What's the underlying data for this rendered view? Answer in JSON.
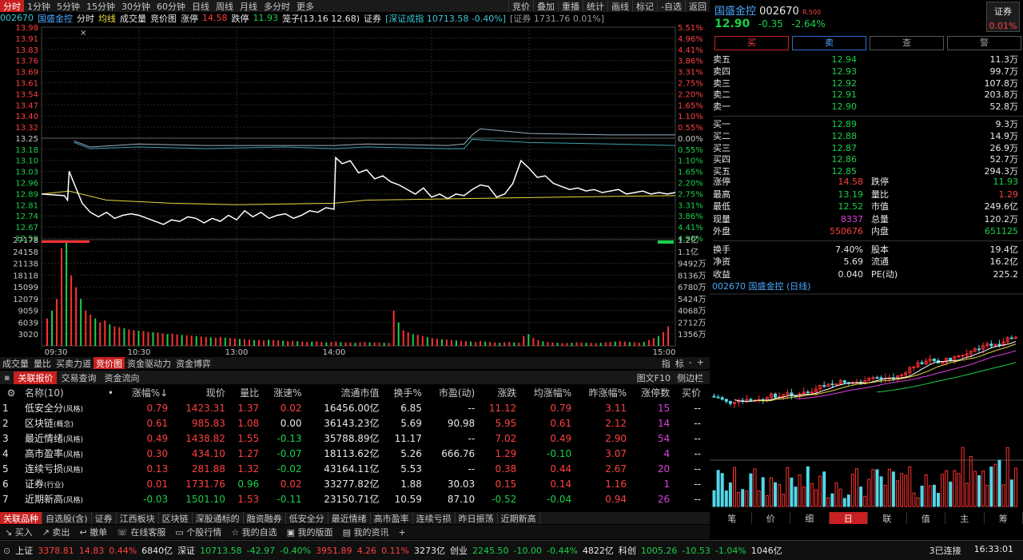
{
  "top_tabs": [
    "分时",
    "1分钟",
    "5分钟",
    "15分钟",
    "30分钟",
    "60分钟",
    "日线",
    "周线",
    "月线",
    "多分时",
    "更多"
  ],
  "top_tools": [
    "竞价",
    "叠加",
    "重播",
    "统计",
    "画线",
    "标记",
    "-自选",
    "返回"
  ],
  "chart_header": {
    "code": "002670",
    "name": "国盛金控",
    "items": [
      "分时",
      "均线",
      "成交量",
      "竞价图"
    ],
    "zt_label": "涨停",
    "zt_val": "14.58",
    "dt_label": "跌停",
    "dt_val": "11.93",
    "bz": "笼子(13.16 12.68)",
    "sec": "证券",
    "idx1": "[深证成指 10713.58 -0.40%]",
    "idx2": "[证券 1731.76 0.01%]"
  },
  "chart_data": {
    "type": "line",
    "time_ticks": [
      "09:30",
      "10:30",
      "13:00",
      "14:00",
      "15:00"
    ],
    "price_ticks": [
      "13.98",
      "13.91",
      "13.83",
      "13.76",
      "13.69",
      "13.61",
      "13.54",
      "13.47",
      "13.40",
      "13.32",
      "13.25",
      "13.18",
      "13.10",
      "13.03",
      "12.96",
      "12.89",
      "12.81",
      "12.74",
      "12.67",
      "12.59"
    ],
    "pct_ticks": [
      "5.51%",
      "4.96%",
      "4.41%",
      "3.86%",
      "3.31%",
      "2.75%",
      "2.20%",
      "1.65%",
      "1.10%",
      "0.55%",
      "0.00%",
      "0.55%",
      "1.10%",
      "1.65%",
      "2.20%",
      "2.75%",
      "3.31%",
      "3.86%",
      "4.41%",
      "4.96%"
    ],
    "pct_colors": [
      "#ff4040",
      "#ff4040",
      "#ff4040",
      "#ff4040",
      "#ff4040",
      "#ff4040",
      "#ff4040",
      "#ff4040",
      "#ff4040",
      "#ff4040",
      "#c8c8c8",
      "#19d04a",
      "#19d04a",
      "#19d04a",
      "#19d04a",
      "#19d04a",
      "#19d04a",
      "#19d04a",
      "#19d04a",
      "#19d04a"
    ],
    "ylim": [
      12.59,
      13.98
    ],
    "prev_close": 13.25,
    "price_series": [
      [
        0,
        12.88
      ],
      [
        14,
        12.87
      ],
      [
        16,
        12.84
      ],
      [
        17,
        13.03
      ],
      [
        20,
        12.95
      ],
      [
        25,
        12.82
      ],
      [
        30,
        12.76
      ],
      [
        35,
        12.73
      ],
      [
        40,
        12.76
      ],
      [
        45,
        12.72
      ],
      [
        50,
        12.74
      ],
      [
        55,
        12.75
      ],
      [
        60,
        12.74
      ],
      [
        65,
        12.72
      ],
      [
        70,
        12.7
      ],
      [
        75,
        12.68
      ],
      [
        80,
        12.71
      ],
      [
        85,
        12.7
      ],
      [
        90,
        12.73
      ],
      [
        95,
        12.72
      ],
      [
        100,
        12.69
      ],
      [
        105,
        12.72
      ],
      [
        110,
        12.7
      ],
      [
        115,
        12.74
      ],
      [
        120,
        12.71
      ],
      [
        125,
        12.77
      ],
      [
        130,
        12.73
      ],
      [
        135,
        12.76
      ],
      [
        140,
        12.72
      ],
      [
        145,
        12.74
      ],
      [
        150,
        12.75
      ],
      [
        155,
        12.72
      ],
      [
        160,
        12.74
      ],
      [
        165,
        12.77
      ],
      [
        170,
        12.76
      ],
      [
        175,
        12.79
      ],
      [
        180,
        12.78
      ],
      [
        181,
        13.12
      ],
      [
        185,
        13.08
      ],
      [
        190,
        13.1
      ],
      [
        195,
        13.02
      ],
      [
        200,
        13.04
      ],
      [
        205,
        12.98
      ],
      [
        210,
        13.0
      ],
      [
        215,
        12.96
      ],
      [
        220,
        12.94
      ],
      [
        225,
        12.91
      ],
      [
        230,
        12.88
      ],
      [
        235,
        12.92
      ],
      [
        240,
        12.86
      ],
      [
        245,
        12.88
      ],
      [
        250,
        12.85
      ],
      [
        255,
        12.88
      ],
      [
        260,
        12.87
      ],
      [
        265,
        12.91
      ],
      [
        270,
        12.94
      ],
      [
        275,
        12.93
      ],
      [
        280,
        12.86
      ],
      [
        285,
        12.88
      ],
      [
        290,
        12.95
      ],
      [
        295,
        13.1
      ],
      [
        300,
        13.05
      ],
      [
        305,
        12.99
      ],
      [
        310,
        13.0
      ],
      [
        315,
        12.95
      ],
      [
        320,
        12.93
      ],
      [
        325,
        12.91
      ],
      [
        330,
        12.92
      ],
      [
        335,
        12.9
      ],
      [
        340,
        12.91
      ],
      [
        345,
        12.89
      ],
      [
        350,
        12.9
      ],
      [
        355,
        12.91
      ],
      [
        360,
        12.88
      ],
      [
        365,
        12.89
      ],
      [
        370,
        12.9
      ],
      [
        375,
        12.88
      ],
      [
        380,
        12.89
      ],
      [
        385,
        12.88
      ],
      [
        390,
        12.89
      ]
    ],
    "avg_series": [
      [
        0,
        12.88
      ],
      [
        17,
        12.9
      ],
      [
        40,
        12.84
      ],
      [
        80,
        12.82
      ],
      [
        120,
        12.81
      ],
      [
        180,
        12.82
      ],
      [
        200,
        12.84
      ],
      [
        260,
        12.85
      ],
      [
        320,
        12.86
      ],
      [
        390,
        12.87
      ]
    ],
    "idx_series1": [
      [
        20,
        13.23
      ],
      [
        30,
        13.19
      ],
      [
        60,
        13.21
      ],
      [
        100,
        13.2
      ],
      [
        150,
        13.2
      ],
      [
        180,
        13.2
      ],
      [
        200,
        13.21
      ],
      [
        250,
        13.2
      ],
      [
        260,
        13.21
      ],
      [
        265,
        13.27
      ],
      [
        270,
        13.31
      ],
      [
        300,
        13.28
      ],
      [
        350,
        13.27
      ],
      [
        390,
        13.27
      ]
    ],
    "idx_series2": [
      [
        20,
        13.22
      ],
      [
        30,
        13.18
      ],
      [
        60,
        13.19
      ],
      [
        100,
        13.18
      ],
      [
        150,
        13.19
      ],
      [
        180,
        13.18
      ],
      [
        200,
        13.19
      ],
      [
        250,
        13.18
      ],
      [
        260,
        13.18
      ],
      [
        265,
        13.24
      ],
      [
        300,
        13.22
      ],
      [
        350,
        13.21
      ],
      [
        390,
        13.2
      ]
    ],
    "vol_ticks": [
      "27178",
      "24158",
      "21138",
      "18118",
      "15099",
      "12079",
      "9059",
      "6039",
      "3020"
    ],
    "amt_ticks": [
      "1.2亿",
      "1.1亿",
      "9492万",
      "8136万",
      "6780万",
      "5424万",
      "4068万",
      "2712万",
      "1356万"
    ],
    "vol_max": 27178,
    "vol_series": [
      7000,
      9000,
      12000,
      25000,
      27000,
      18000,
      15000,
      12000,
      9000,
      8000,
      7000,
      6000,
      6500,
      5500,
      5000,
      4800,
      4500,
      4200,
      4000,
      3900,
      3800,
      3600,
      3500,
      3400,
      3200,
      3000,
      3100,
      2900,
      2800,
      2700,
      2600,
      2500,
      2400,
      2300,
      2200,
      2100,
      2300,
      2100,
      2000,
      1900,
      1800,
      1700,
      1600,
      1500,
      1500,
      1400,
      1600,
      1500,
      1400,
      1300,
      1200,
      1300,
      1200,
      1100,
      1000,
      1100,
      1200,
      1000,
      900,
      1000,
      1100,
      950,
      900,
      850,
      800,
      900,
      1000,
      950,
      900,
      850,
      800,
      750,
      9000,
      6000,
      4000,
      3500,
      3000,
      2800,
      2500,
      2200,
      2000,
      1800,
      1700,
      1600,
      1500,
      1400,
      1300,
      1200,
      1100,
      1000,
      1200,
      1100,
      1000,
      900,
      800,
      900,
      1000,
      900,
      800,
      2500,
      3000,
      2000,
      1500,
      1200,
      1000,
      900,
      800,
      700,
      750,
      800,
      900,
      850,
      800,
      750,
      700,
      800,
      900,
      1000,
      1100,
      1200,
      1100,
      1000,
      900,
      800,
      1000,
      1500,
      2000,
      2500,
      3500,
      5000
    ]
  },
  "ind_tabs": [
    "成交量",
    "量比",
    "买卖力道",
    "竞价图",
    "资金驱动力",
    "资金博弈"
  ],
  "ind_tabs_active": 3,
  "ind_right": [
    "指",
    "标",
    "-",
    "+"
  ],
  "low_tabs": [
    "关联报价",
    "交易查询",
    "资金流向"
  ],
  "low_right": [
    "图文F10",
    "侧边栏"
  ],
  "table": {
    "headers": [
      "名称(10)",
      "•",
      "涨幅%↓",
      "现价",
      "量比",
      "涨速%",
      "流通市值",
      "换手%",
      "市盈(动)",
      "涨跌",
      "均涨幅%",
      "昨涨幅%",
      "涨停数",
      "买价"
    ],
    "rows": [
      {
        "no": "1",
        "name": "低安全分",
        "tag": "(风格)",
        "zf": "0.79",
        "xj": "1423.31",
        "lb": "1.37",
        "zs": "0.02",
        "lt": "16456.00亿",
        "hs": "6.85",
        "sy": "--",
        "zd": "11.12",
        "jz": "0.79",
        "zz": "3.11",
        "zt": "15",
        "mj": "--"
      },
      {
        "no": "2",
        "name": "区块链",
        "tag": "(概念)",
        "zf": "0.61",
        "xj": "985.83",
        "lb": "1.08",
        "zs": "0.00",
        "lt": "36143.23亿",
        "hs": "5.69",
        "sy": "90.98",
        "zd": "5.95",
        "jz": "0.61",
        "zz": "2.12",
        "zt": "14",
        "mj": "--"
      },
      {
        "no": "3",
        "name": "最近情绪",
        "tag": "(风格)",
        "zf": "0.49",
        "xj": "1438.82",
        "lb": "1.55",
        "zs": "-0.13",
        "lt": "35788.89亿",
        "hs": "11.17",
        "sy": "--",
        "zd": "7.02",
        "jz": "0.49",
        "zz": "2.90",
        "zt": "54",
        "mj": "--"
      },
      {
        "no": "4",
        "name": "高市盈率",
        "tag": "(风格)",
        "zf": "0.30",
        "xj": "434.10",
        "lb": "1.27",
        "zs": "-0.07",
        "lt": "18113.62亿",
        "hs": "5.26",
        "sy": "666.76",
        "zd": "1.29",
        "jz": "-0.10",
        "zz": "3.07",
        "zt": "4",
        "mj": "--"
      },
      {
        "no": "5",
        "name": "连续亏损",
        "tag": "(风格)",
        "zf": "0.13",
        "xj": "281.88",
        "lb": "1.32",
        "zs": "-0.02",
        "lt": "43164.11亿",
        "hs": "5.53",
        "sy": "--",
        "zd": "0.38",
        "jz": "0.44",
        "zz": "2.67",
        "zt": "20",
        "mj": "--"
      },
      {
        "no": "6",
        "name": "证券",
        "tag": "(行业)",
        "zf": "0.01",
        "xj": "1731.76",
        "lb": "0.96",
        "zs": "0.02",
        "lt": "33277.82亿",
        "hs": "1.88",
        "sy": "30.03",
        "zd": "0.15",
        "jz": "0.14",
        "zz": "1.16",
        "zt": "1",
        "mj": "--"
      },
      {
        "no": "7",
        "name": "近期新高",
        "tag": "(风格)",
        "zf": "-0.03",
        "xj": "1501.10",
        "lb": "1.53",
        "zs": "-0.11",
        "lt": "23150.71亿",
        "hs": "10.59",
        "sy": "87.10",
        "zd": "-0.52",
        "jz": "-0.04",
        "zz": "0.94",
        "zt": "26",
        "mj": "--"
      }
    ]
  },
  "sec_tabs": [
    "关联品种",
    "自选股(含)",
    "证券",
    "江西板块",
    "区块链",
    "深股通标的",
    "融资融券",
    "低安全分",
    "最近情绪",
    "高市盈率",
    "连续亏损",
    "昨日振荡",
    "近期新高"
  ],
  "actions": [
    "买入",
    "卖出",
    "撤单",
    "在线客服",
    "个股行情",
    "我的自选",
    "我的版面",
    "我的资讯",
    "+"
  ],
  "status": [
    {
      "t": "上证",
      "c": "#e8e8e8"
    },
    {
      "t": "3378.81",
      "c": "#ff4040"
    },
    {
      "t": "14.83",
      "c": "#ff4040"
    },
    {
      "t": "0.44%",
      "c": "#ff4040"
    },
    {
      "t": "6840亿",
      "c": "#e8e8e8"
    },
    {
      "t": "深证",
      "c": "#e8e8e8"
    },
    {
      "t": "10713.58",
      "c": "#19d04a"
    },
    {
      "t": "-42.97",
      "c": "#19d04a"
    },
    {
      "t": "-0.40%",
      "c": "#19d04a"
    },
    {
      "t": "3951.89",
      "c": "#ff4040"
    },
    {
      "t": "4.26",
      "c": "#ff4040"
    },
    {
      "t": "0.11%",
      "c": "#ff4040"
    },
    {
      "t": "3273亿",
      "c": "#e8e8e8"
    },
    {
      "t": "创业",
      "c": "#e8e8e8"
    },
    {
      "t": "2245.50",
      "c": "#19d04a"
    },
    {
      "t": "-10.00",
      "c": "#19d04a"
    },
    {
      "t": "-0.44%",
      "c": "#19d04a"
    },
    {
      "t": "4822亿",
      "c": "#e8e8e8"
    },
    {
      "t": "科创",
      "c": "#e8e8e8"
    },
    {
      "t": "1005.26",
      "c": "#19d04a"
    },
    {
      "t": "-10.53",
      "c": "#19d04a"
    },
    {
      "t": "-1.04%",
      "c": "#19d04a"
    },
    {
      "t": "1046亿",
      "c": "#e8e8e8"
    }
  ],
  "status_right": {
    "conn": "3已连接",
    "time": "16:33:01"
  },
  "right": {
    "name": "国盛金控",
    "code": "002670",
    "tag": "R.500",
    "price": "12.90",
    "chg": "-0.35",
    "pct": "-2.64%",
    "sec_label": "证券",
    "sec_pct": "0.01%",
    "buttons": [
      "买",
      "卖",
      "查",
      "警"
    ],
    "asks": [
      [
        "卖五",
        "12.94",
        "11.3万"
      ],
      [
        "卖四",
        "12.93",
        "99.7万"
      ],
      [
        "卖三",
        "12.92",
        "107.8万"
      ],
      [
        "卖二",
        "12.91",
        "203.8万"
      ],
      [
        "卖一",
        "12.90",
        "52.8万"
      ]
    ],
    "bids": [
      [
        "买一",
        "12.89",
        "9.3万"
      ],
      [
        "买二",
        "12.88",
        "14.9万"
      ],
      [
        "买三",
        "12.87",
        "26.9万"
      ],
      [
        "买四",
        "12.86",
        "52.7万"
      ],
      [
        "买五",
        "12.85",
        "294.3万"
      ]
    ],
    "stats": [
      [
        "涨停",
        "14.58",
        "#ff4040",
        "跌停",
        "11.93",
        "#19d04a"
      ],
      [
        "最高",
        "13.19",
        "#19d04a",
        "量比",
        "1.29",
        "#ff4040"
      ],
      [
        "最低",
        "12.52",
        "#19d04a",
        "市值",
        "249.6亿",
        "#e8e8e8"
      ],
      [
        "现量",
        "8337",
        "#e040e0",
        "总量",
        "120.2万",
        "#e8e8e8"
      ],
      [
        "外盘",
        "550676",
        "#ff4040",
        "内盘",
        "651125",
        "#19d04a"
      ]
    ],
    "stats2": [
      [
        "换手",
        "7.40%",
        "股本",
        "19.4亿"
      ],
      [
        "净资",
        "5.69",
        "流通",
        "16.2亿"
      ],
      [
        "收益",
        "0.040",
        "PE(动)",
        "225.2"
      ]
    ],
    "kline_title": "002670 国盛金控 (日线)",
    "bottom_tabs": [
      "笔",
      "价",
      "细",
      "日",
      "联",
      "值",
      "主",
      "筹"
    ],
    "bottom_active": 3
  }
}
